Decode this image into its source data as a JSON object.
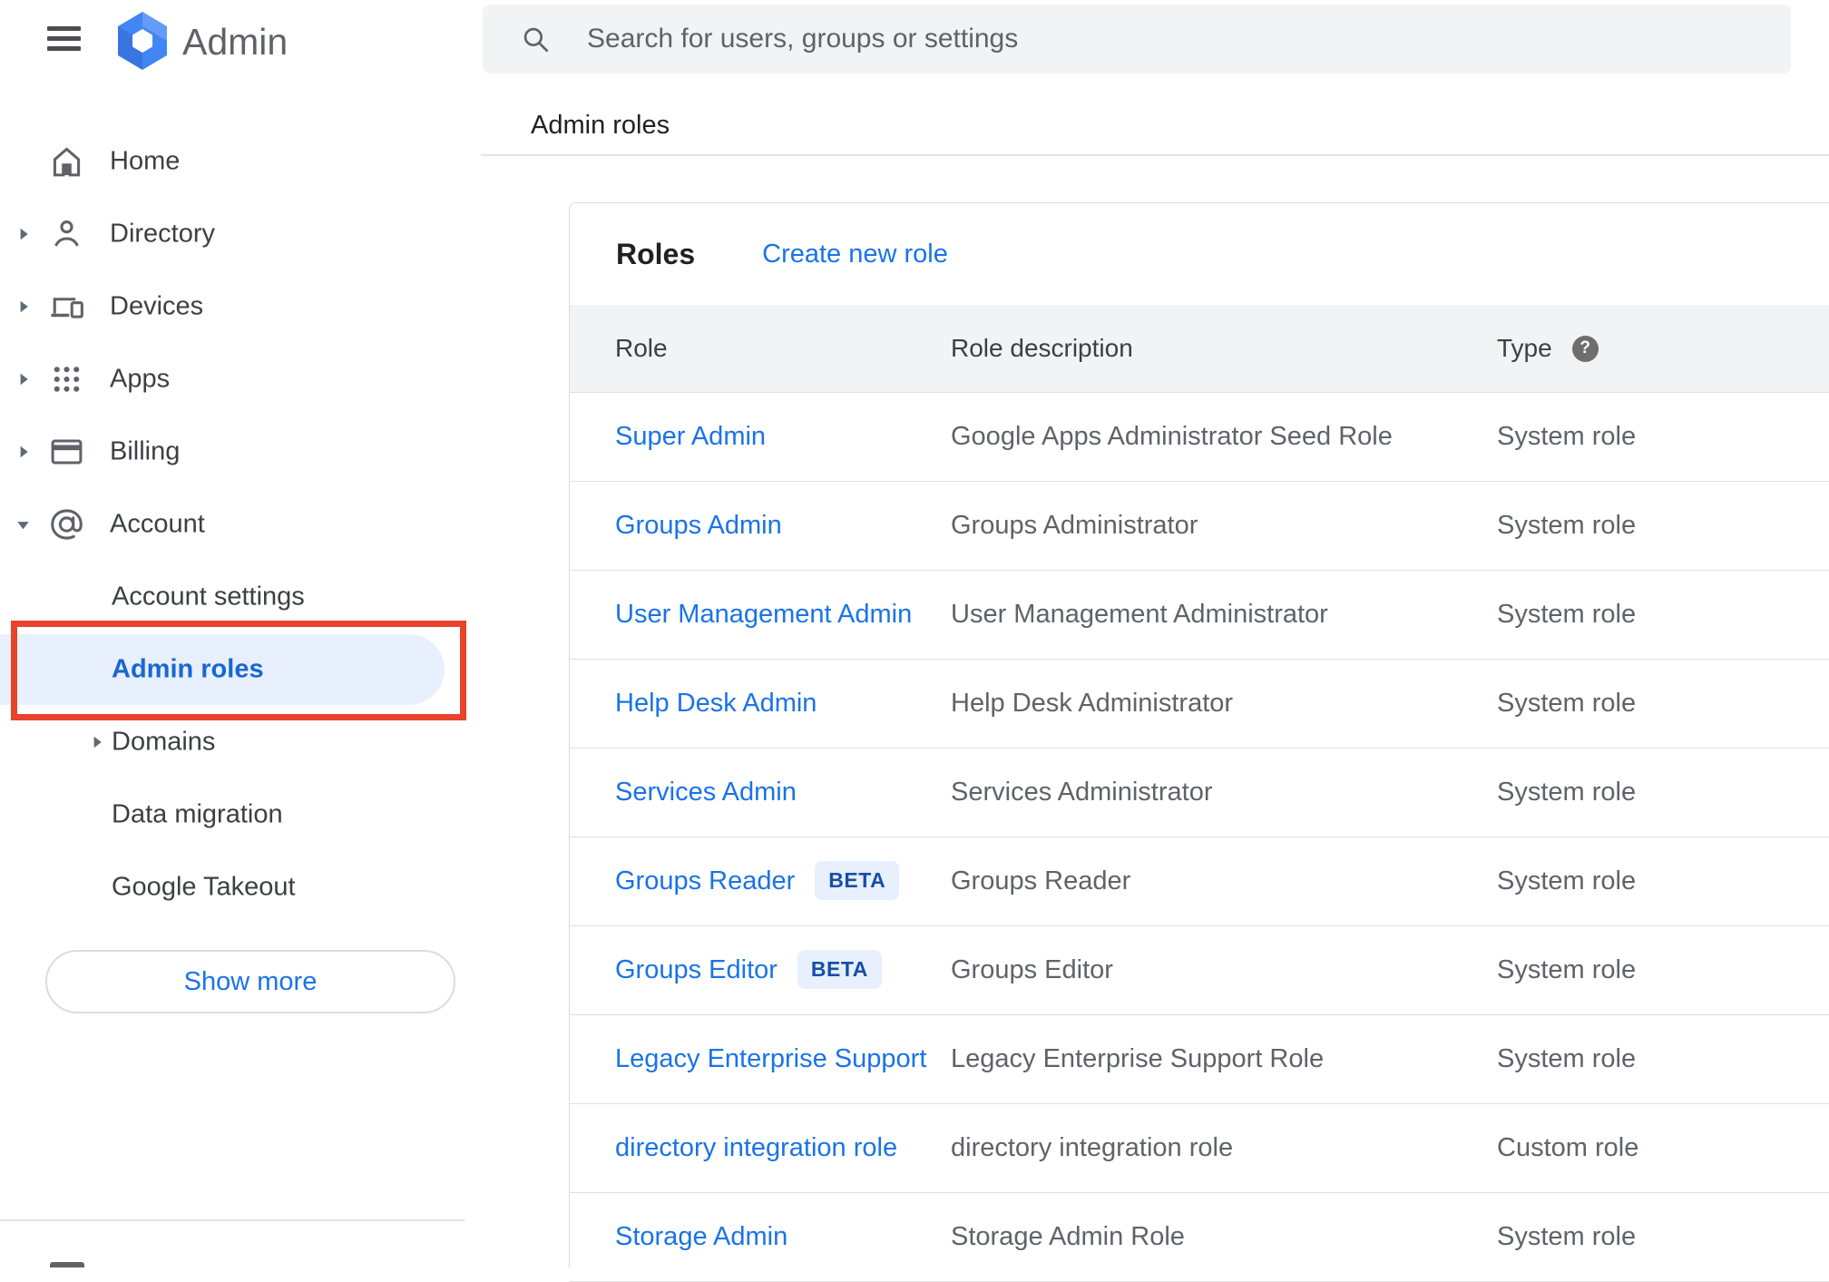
{
  "app": {
    "product_name": "Admin"
  },
  "search": {
    "placeholder": "Search for users, groups or settings"
  },
  "breadcrumb": "Admin roles",
  "sidebar": {
    "items": [
      {
        "label": "Home",
        "icon": "home-icon",
        "caret": null
      },
      {
        "label": "Directory",
        "icon": "person-icon",
        "caret": "caret-right-icon"
      },
      {
        "label": "Devices",
        "icon": "devices-icon",
        "caret": "caret-right-icon"
      },
      {
        "label": "Apps",
        "icon": "apps-icon",
        "caret": "caret-right-icon"
      },
      {
        "label": "Billing",
        "icon": "card-icon",
        "caret": "caret-right-icon"
      },
      {
        "label": "Account",
        "icon": "at-icon",
        "caret": "caret-down-icon"
      },
      {
        "label": "Account settings",
        "icon": null,
        "caret": null,
        "sub": true
      },
      {
        "label": "Admin roles",
        "icon": null,
        "caret": null,
        "sub": true,
        "selected": true,
        "annotated": true
      },
      {
        "label": "Domains",
        "icon": null,
        "caret": "caret-right-icon",
        "sub": true
      },
      {
        "label": "Data migration",
        "icon": null,
        "caret": null,
        "sub": true
      },
      {
        "label": "Google Takeout",
        "icon": null,
        "caret": null,
        "sub": true
      }
    ],
    "show_more_label": "Show more"
  },
  "main": {
    "title": "Roles",
    "create_link": "Create new role",
    "table": {
      "columns": [
        "Role",
        "Role description",
        "Type"
      ],
      "help_glyph": "?",
      "rows": [
        {
          "role": "Super Admin",
          "badge": null,
          "description": "Google Apps Administrator Seed Role",
          "type": "System role"
        },
        {
          "role": "Groups Admin",
          "badge": null,
          "description": "Groups Administrator",
          "type": "System role"
        },
        {
          "role": "User Management Admin",
          "badge": null,
          "description": "User Management Administrator",
          "type": "System role"
        },
        {
          "role": "Help Desk Admin",
          "badge": null,
          "description": "Help Desk Administrator",
          "type": "System role"
        },
        {
          "role": "Services Admin",
          "badge": null,
          "description": "Services Administrator",
          "type": "System role"
        },
        {
          "role": "Groups Reader",
          "badge": "BETA",
          "description": "Groups Reader",
          "type": "System role"
        },
        {
          "role": "Groups Editor",
          "badge": "BETA",
          "description": "Groups Editor",
          "type": "System role"
        },
        {
          "role": "Legacy Enterprise Support",
          "badge": null,
          "description": "Legacy Enterprise Support Role",
          "type": "System role"
        },
        {
          "role": "directory integration role",
          "badge": null,
          "description": "directory integration role",
          "type": "Custom role"
        },
        {
          "role": "Storage Admin",
          "badge": null,
          "description": "Storage Admin Role",
          "type": "System role"
        }
      ]
    }
  },
  "colors": {
    "link_blue": "#1a73e8",
    "selected_text": "#1967d2",
    "selected_bg": "#e8f0fe",
    "annotation_red": "#e8432b",
    "beta_text": "#174ea6",
    "beta_bg": "#e8f0fe",
    "icon_gray": "#5f6368",
    "text_dark": "#3c4043",
    "text_black": "#202124",
    "surface_gray": "#f1f3f4",
    "border_gray": "#dadce0",
    "row_line": "#e0e0e0",
    "brand_blue": "#4285f4"
  }
}
